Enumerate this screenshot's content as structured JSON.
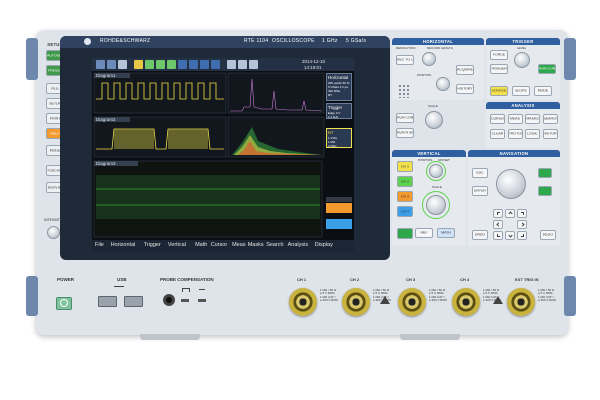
{
  "brand": {
    "name": "ROHDE&SCHWARZ",
    "model": "RTE 1104",
    "type": "OSCILLOSCOPE",
    "bandwidth": "1 GHz",
    "sample_rate": "5 GSa/s"
  },
  "left_panel": {
    "section_label": "SETUP",
    "buttons": [
      "AUTOSET",
      "PRESET",
      "FILE",
      "SETUP",
      "PRINT",
      "HELP",
      "MODE",
      "TOUCHSCREEN LOCK",
      "DISPLAY"
    ],
    "intensity_label": "INTENSITY"
  },
  "screen": {
    "menu": [
      "File",
      "Horizontal",
      "Trigger",
      "Vertical",
      "Math",
      "Cursor",
      "Meas",
      "Masks",
      "Search",
      "Analysis",
      "Display"
    ],
    "panels": {
      "top_left_title": "Diagram1",
      "mid_left_title": "Diagram2",
      "bottom_title": "Diagram3"
    },
    "info": {
      "date": "2014-12-10",
      "time": "14:19:01",
      "horizontal_title": "Horizontal",
      "horizontal_lines": [
        "200 µs/div 50 %",
        "5 GSa/s 1.1 µs",
        "400 MSa",
        "RT"
      ],
      "trigger_title": "Trigger",
      "trigger_lines": [
        "Edge 0 V",
        "2.1 kHz"
      ],
      "rt_label": "RT",
      "ch1_lines": [
        "1 V/div",
        "1 MΩ",
        "2 MHz"
      ]
    }
  },
  "horizontal_section": {
    "label": "HORIZONTAL",
    "resolution_label": "RESOLUTION",
    "record_length_label": "RECORD LENGTH",
    "position_label": "POSITION",
    "run_stop_label": "RUN STOP",
    "scale_label": "SCALE",
    "zoom_label": "ZOOM",
    "ref_label": "REF",
    "buttons": [
      "REC TO LEN",
      "RUN CONT",
      "RUN N SINGLE",
      "ACQUIRE",
      "HISTORY"
    ]
  },
  "trigger_section": {
    "label": "TRIGGER",
    "level_label": "LEVEL",
    "buttons": [
      "TRIGGER",
      "RUN CONT",
      "SOURCE",
      "SLOPE",
      "MODE",
      "FORCE"
    ]
  },
  "analysis_section": {
    "label": "ANALYSIS",
    "buttons": [
      "CURSOR",
      "MEAS",
      "MASKS",
      "SEARCH",
      "CLEAR",
      "PROTOCOL",
      "LOGIC",
      "HISTORY"
    ]
  },
  "vertical_section": {
    "label": "VERTICAL",
    "position_label": "POSITION",
    "offset_label": "OFFSET",
    "scale_label": "SCALE",
    "channels": [
      "CH 1",
      "CH 2",
      "CH 3",
      "CH 4"
    ],
    "buttons": [
      "REF",
      "MATH"
    ]
  },
  "navigation_section": {
    "label": "NAVIGATION",
    "buttons": [
      "ESC",
      "ENTER",
      "UNDO",
      "REDO"
    ]
  },
  "front_bottom": {
    "power_label": "POWER",
    "usb_label": "USB",
    "probe_comp_label": "PROBE COMPENSATION",
    "channels": [
      {
        "label": "CH 1",
        "spec": "1 MΩ / 50 Ω\n≤ 5 V RMS\n1 MΩ CAT I\n≤ 300 V RMS"
      },
      {
        "label": "CH 2",
        "spec": "1 MΩ / 50 Ω\n≤ 5 V RMS\n1 MΩ CAT I\n≤ 300 V RMS"
      },
      {
        "label": "CH 3",
        "spec": "1 MΩ / 50 Ω\n≤ 5 V RMS\n1 MΩ CAT I\n≤ 300 V RMS"
      },
      {
        "label": "CH 4",
        "spec": "1 MΩ / 50 Ω\n≤ 5 V RMS\n1 MΩ CAT I\n≤ 300 V RMS"
      },
      {
        "label": "EXT TRIG IN",
        "spec": "1 MΩ / 50 Ω\n≤ 5 V RMS\n1 MΩ CAT I\n≤ 300 V RMS"
      }
    ]
  },
  "colors": {
    "ch1": "#f2e14a",
    "ch2": "#5cd24d",
    "ch3": "#f29a2e",
    "ch4": "#3a9ee8",
    "accent_blue": "#2f5f9e",
    "green_button": "#2ea84a"
  }
}
